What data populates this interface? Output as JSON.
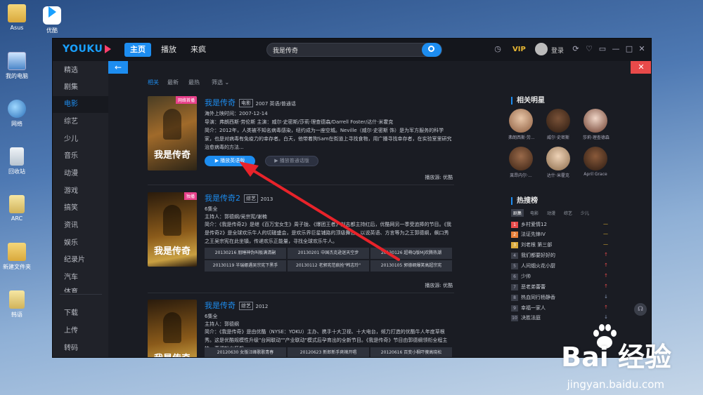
{
  "desktop": {
    "icons": [
      {
        "label": "Asus"
      },
      {
        "label": "优酷"
      },
      {
        "label": "我的电脑"
      },
      {
        "label": "网络"
      },
      {
        "label": "回收站"
      },
      {
        "label": "ARC"
      },
      {
        "label": "新建文件夹"
      },
      {
        "label": "韩语"
      }
    ]
  },
  "app": {
    "logo": "YOUKU",
    "nav": [
      "主页",
      "播放",
      "来疯"
    ],
    "search_value": "我是传奇",
    "vip": "VIP",
    "login": "登录",
    "window_buttons": [
      "⟳",
      "♡",
      "▭",
      "—",
      "□",
      "✕"
    ]
  },
  "sidebar": {
    "items": [
      "精选",
      "剧集",
      "电影",
      "综艺",
      "少儿",
      "音乐",
      "动漫",
      "游戏",
      "搞笑",
      "资讯",
      "娱乐",
      "纪录片",
      "汽车",
      "体育"
    ],
    "bottom": [
      "下载",
      "上传",
      "转码"
    ]
  },
  "filters": [
    "相关",
    "最新",
    "最热",
    "筛选"
  ],
  "results": [
    {
      "title": "我是传奇",
      "badge": "电影",
      "year_info": "2007 英语/普通话",
      "poster_text": "我是传奇",
      "poster_tag": "网络首播",
      "release": "海外上映时间：2007-12-14",
      "cast": "导演：弗朗西斯·劳伦斯    主演：威尔·史密斯/莎莉·理查德森/Darrell Foster/达什·米霍克",
      "desc": "简介：2012年，人类被不知名病毒感染，纽约成为一座空城。Neville（威尔·史密斯 饰）是为军方服务的科学家，也是对病毒有免疫力的幸存者。白天，他带着狗Sam在街道上寻找食物，用广播寻找幸存者，在实验室里研究治愈病毒的方法...",
      "play_primary": "▶ 播放英语版",
      "play_secondary": "▶ 播放普通话版",
      "source": "播放源: 优酷"
    },
    {
      "title": "我是传奇2",
      "badge": "综艺",
      "year_info": "2013",
      "poster_text": "我是传奇",
      "poster_tag": "独播",
      "meta1": "6集全",
      "meta2": "主持人：郭德纲/吴宗宪/谢楠",
      "desc": "简介：《我是传奇2》是继《百万宝女生》周子拢、《爆团王者》刘志都主持红后，优酷网另一季受追捧的节目。《我是传奇2》是全球欢乐牛人的切磋盛会，是欢乐界巨星铺路的顶级舞台。以说英语、方言等为之王郭德纲，飙口秀之王吴宗宪在此坐镇，传递欢乐正能量，寻找全球欢乐牛人。",
      "episodes": [
        "20130216 朋睡神伪叫板满清嗣",
        "20130201 中国杰克逊迷天空步",
        "20130126 超萌Q版Mj欢腾热潮",
        "20130119 半瑞娜遇吴宗宪下黑手",
        "20130112 老郭宪范疯抢\"韩志玲\"",
        "20130105 郭德纲爆笑高超宗宪"
      ],
      "source": "播放源: 优酷"
    },
    {
      "title": "我是传奇",
      "badge": "综艺",
      "year_info": "2012",
      "poster_text": "我是传奇",
      "meta1": "6集全",
      "meta2": "主持人：郭德纲",
      "desc": "简介：《我是传奇》是由优酷（NYSE：YOKU）主办、携手十大卫视、十大电台，倾力打造的优酷牛人年度草根秀。这是优酷规模性升级\"台网联动\"\"产业联动\"模式后孕育出的全新节目。《我是传奇》节目由郭德纲领衔全程主持，高调松出狂飙...",
      "episodes": [
        "20120630 女版汪峰歌歌青春",
        "20120623 新郎新手爽辣开唱",
        "20120616 百变小枫吓傻高晓松"
      ]
    }
  ],
  "related_stars": {
    "heading": "相关明星",
    "stars": [
      "弗朗西斯·劳...",
      "威尔·史密斯",
      "莎莉·理查德森",
      "莱昂内尔·...",
      "达什·米霍克",
      "April Grace"
    ]
  },
  "hot_search": {
    "heading": "热搜榜",
    "tabs": [
      "剧集",
      "电影",
      "动漫",
      "综艺",
      "少儿"
    ],
    "items": [
      {
        "rank": "1",
        "name": "乡村爱情12",
        "trend": "—"
      },
      {
        "rank": "2",
        "name": "法证先锋IV",
        "trend": "—"
      },
      {
        "rank": "3",
        "name": "刘老根 第三部",
        "trend": "—"
      },
      {
        "rank": "4",
        "name": "我们都要好好的",
        "trend": "↑"
      },
      {
        "rank": "5",
        "name": "人间烟火花小厨",
        "trend": "↑"
      },
      {
        "rank": "6",
        "name": "少帅",
        "trend": "↑"
      },
      {
        "rank": "7",
        "name": "恶老弟蕾蕾",
        "trend": "↑"
      },
      {
        "rank": "8",
        "name": "热血同行杨静香",
        "trend": "↓"
      },
      {
        "rank": "9",
        "name": "幸福一家人",
        "trend": "↑"
      },
      {
        "rank": "10",
        "name": "决胜法庭",
        "trend": "↓"
      }
    ]
  },
  "watermark": {
    "brand": "Bai 经验",
    "url": "jingyan.baidu.com"
  },
  "colors": {
    "accent": "#1d8df0",
    "danger": "#e84a4a",
    "bg": "#1a1c23"
  }
}
